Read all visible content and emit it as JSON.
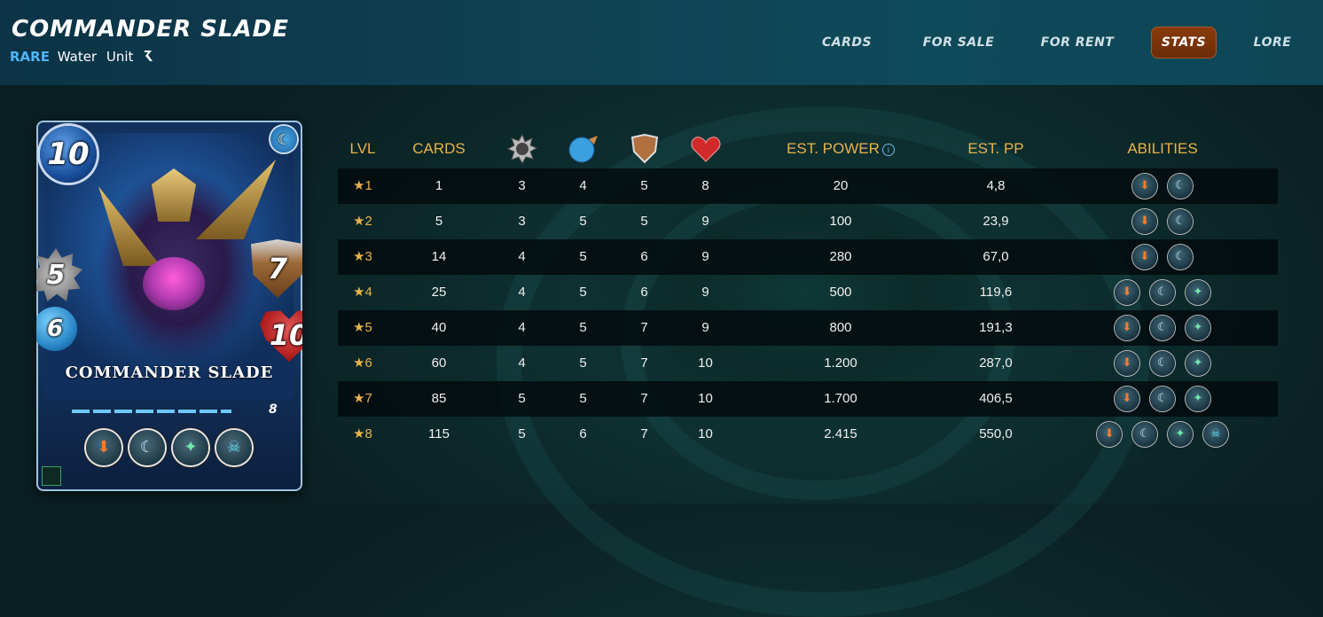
{
  "header": {
    "title": "COMMANDER SLADE",
    "rarity": "RARE",
    "element": "Water",
    "type": "Unit"
  },
  "nav": [
    {
      "label": "CARDS",
      "active": false
    },
    {
      "label": "FOR SALE",
      "active": false
    },
    {
      "label": "FOR RENT",
      "active": false
    },
    {
      "label": "STATS",
      "active": true
    },
    {
      "label": "LORE",
      "active": false
    }
  ],
  "card": {
    "name": "COMMANDER SLADE",
    "mana": "10",
    "melee": "5",
    "ranged": "6",
    "armor": "7",
    "health": "10",
    "level": "8",
    "abilities": [
      "inspire-icon",
      "reach-icon",
      "void-icon",
      "cleanse-icon"
    ]
  },
  "table": {
    "headers": [
      "LVL",
      "CARDS",
      "melee-icon",
      "ranged-icon",
      "armor-icon",
      "health-icon",
      "EST. POWER",
      "EST. PP",
      "ABILITIES"
    ],
    "rows": [
      {
        "lvl": "1",
        "cards": "1",
        "melee": "3",
        "ranged": "4",
        "armor": "5",
        "health": "8",
        "power": "20",
        "pp": "4,8",
        "abilities": 2
      },
      {
        "lvl": "2",
        "cards": "5",
        "melee": "3",
        "ranged": "5",
        "armor": "5",
        "health": "9",
        "power": "100",
        "pp": "23,9",
        "abilities": 2
      },
      {
        "lvl": "3",
        "cards": "14",
        "melee": "4",
        "ranged": "5",
        "armor": "6",
        "health": "9",
        "power": "280",
        "pp": "67,0",
        "abilities": 2
      },
      {
        "lvl": "4",
        "cards": "25",
        "melee": "4",
        "ranged": "5",
        "armor": "6",
        "health": "9",
        "power": "500",
        "pp": "119,6",
        "abilities": 3
      },
      {
        "lvl": "5",
        "cards": "40",
        "melee": "4",
        "ranged": "5",
        "armor": "7",
        "health": "9",
        "power": "800",
        "pp": "191,3",
        "abilities": 3
      },
      {
        "lvl": "6",
        "cards": "60",
        "melee": "4",
        "ranged": "5",
        "armor": "7",
        "health": "10",
        "power": "1.200",
        "pp": "287,0",
        "abilities": 3
      },
      {
        "lvl": "7",
        "cards": "85",
        "melee": "5",
        "ranged": "5",
        "armor": "7",
        "health": "10",
        "power": "1.700",
        "pp": "406,5",
        "abilities": 3
      },
      {
        "lvl": "8",
        "cards": "115",
        "melee": "5",
        "ranged": "6",
        "armor": "7",
        "health": "10",
        "power": "2.415",
        "pp": "550,0",
        "abilities": 4
      }
    ]
  },
  "colors": {
    "accent": "#e8b34a",
    "rarity": "#4fb6ff",
    "active_tab": "#7a340a"
  }
}
